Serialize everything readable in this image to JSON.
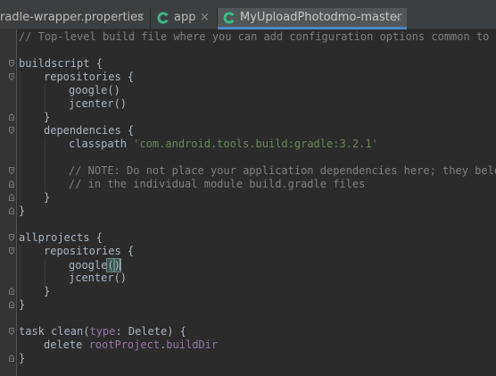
{
  "tabs": [
    {
      "label": "radle-wrapper.properties",
      "icon": "properties-file-icon",
      "close": "×"
    },
    {
      "label": "app",
      "icon": "gradle-icon",
      "close": "×"
    },
    {
      "label": "MyUploadPhotodmo-master",
      "icon": "gradle-icon",
      "close": "×",
      "active": true
    }
  ],
  "editor": {
    "lines": {
      "l1": "// Top-level build file where you can add configuration options common to all sub-projects/modules.",
      "l3": "buildscript {",
      "l4": "repositories {",
      "l5": "google()",
      "l6": "jcenter()",
      "l7": "}",
      "l8": "dependencies {",
      "l9_kw": "classpath ",
      "l9_str": "'com.android.tools.build:gradle:3.2.1'",
      "l11": "// NOTE: Do not place your application dependencies here; they belong",
      "l12": "// in the individual module build.gradle files",
      "l13": "}",
      "l14": "}",
      "l16": "allprojects {",
      "l17": "repositories {",
      "l18_a": "google",
      "l18_b": "(",
      "l18_c": ")",
      "l19": "jcenter()",
      "l20": "}",
      "l21": "}",
      "l23_a": "task clean(",
      "l23_b": "type",
      "l23_c": ": Delete) {",
      "l24_a": "delete ",
      "l24_b": "rootProject",
      "l24_c": ".",
      "l24_d": "buildDir",
      "l25": "}"
    }
  },
  "colors": {
    "background": "#2b2b2b",
    "comment": "#808080",
    "string": "#6a8759",
    "named_arg": "#9876aa",
    "text": "#a9b7c6",
    "tab_accent": "#4a88c7",
    "gradle_icon": "#3dbb83"
  }
}
